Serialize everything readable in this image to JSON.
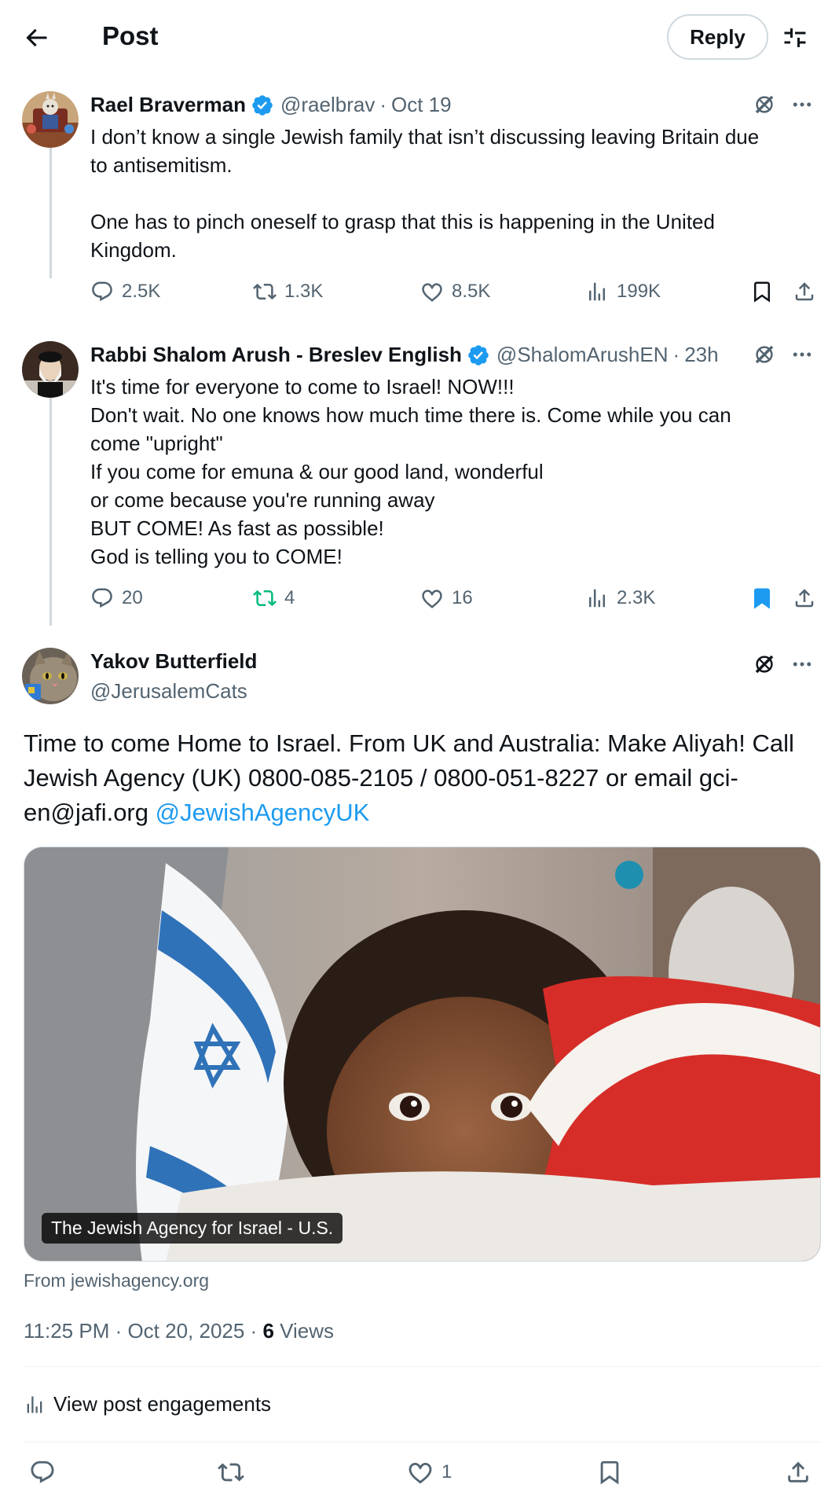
{
  "header": {
    "title": "Post",
    "reply_label": "Reply"
  },
  "tweets": [
    {
      "name": "Rael Braverman",
      "handle": "@raelbrav",
      "time": "Oct 19",
      "lines": [
        "I don’t know a single Jewish family that isn’t discussing leaving Britain due",
        "to antisemitism.",
        "",
        "One has to pinch oneself to grasp that this is happening in the United",
        "Kingdom."
      ],
      "replies": "2.5K",
      "reposts": "1.3K",
      "likes": "8.5K",
      "views": "199K"
    },
    {
      "name": "Rabbi Shalom Arush - Breslev English",
      "handle": "@ShalomArushEN",
      "time": "23h",
      "lines": [
        "It's time for everyone to come to Israel! NOW!!!",
        "Don't wait. No one knows how much time there is. Come while you can",
        "come \"upright\"",
        "If you come for emuna & our good land, wonderful",
        "or come because you're running away",
        "BUT COME! As fast as possible!",
        "God is telling you to COME!"
      ],
      "replies": "20",
      "reposts": "4",
      "likes": "16",
      "views": "2.3K"
    }
  ],
  "main": {
    "name": "Yakov Butterfield",
    "handle": "@JerusalemCats",
    "text_lines": [
      "Time to come Home to Israel. From UK and Australia: Make Aliyah! Call",
      "Jewish Agency (UK) 0800-085-2105 / 0800-051-8227 or email gci-",
      "en@jafi.org "
    ],
    "mention": "@JewishAgencyUK",
    "card_label": "The Jewish Agency for Israel - U.S.",
    "card_source": "From jewishagency.org",
    "timestamp": "11:25 PM · Oct 20, 2025 · ",
    "views_count": "6",
    "views_label": " Views",
    "engagements_label": "View post engagements",
    "likes": "1"
  },
  "colors": {
    "accent": "#1d9bf0",
    "repost_active": "#00ba7c",
    "muted": "#536471",
    "border": "#cfd9de"
  },
  "icons": [
    "back-arrow-icon",
    "filter-icon",
    "verified-badge-icon",
    "grok-icon",
    "more-icon",
    "reply-icon",
    "repost-icon",
    "like-icon",
    "views-icon",
    "bookmark-icon",
    "share-icon"
  ]
}
